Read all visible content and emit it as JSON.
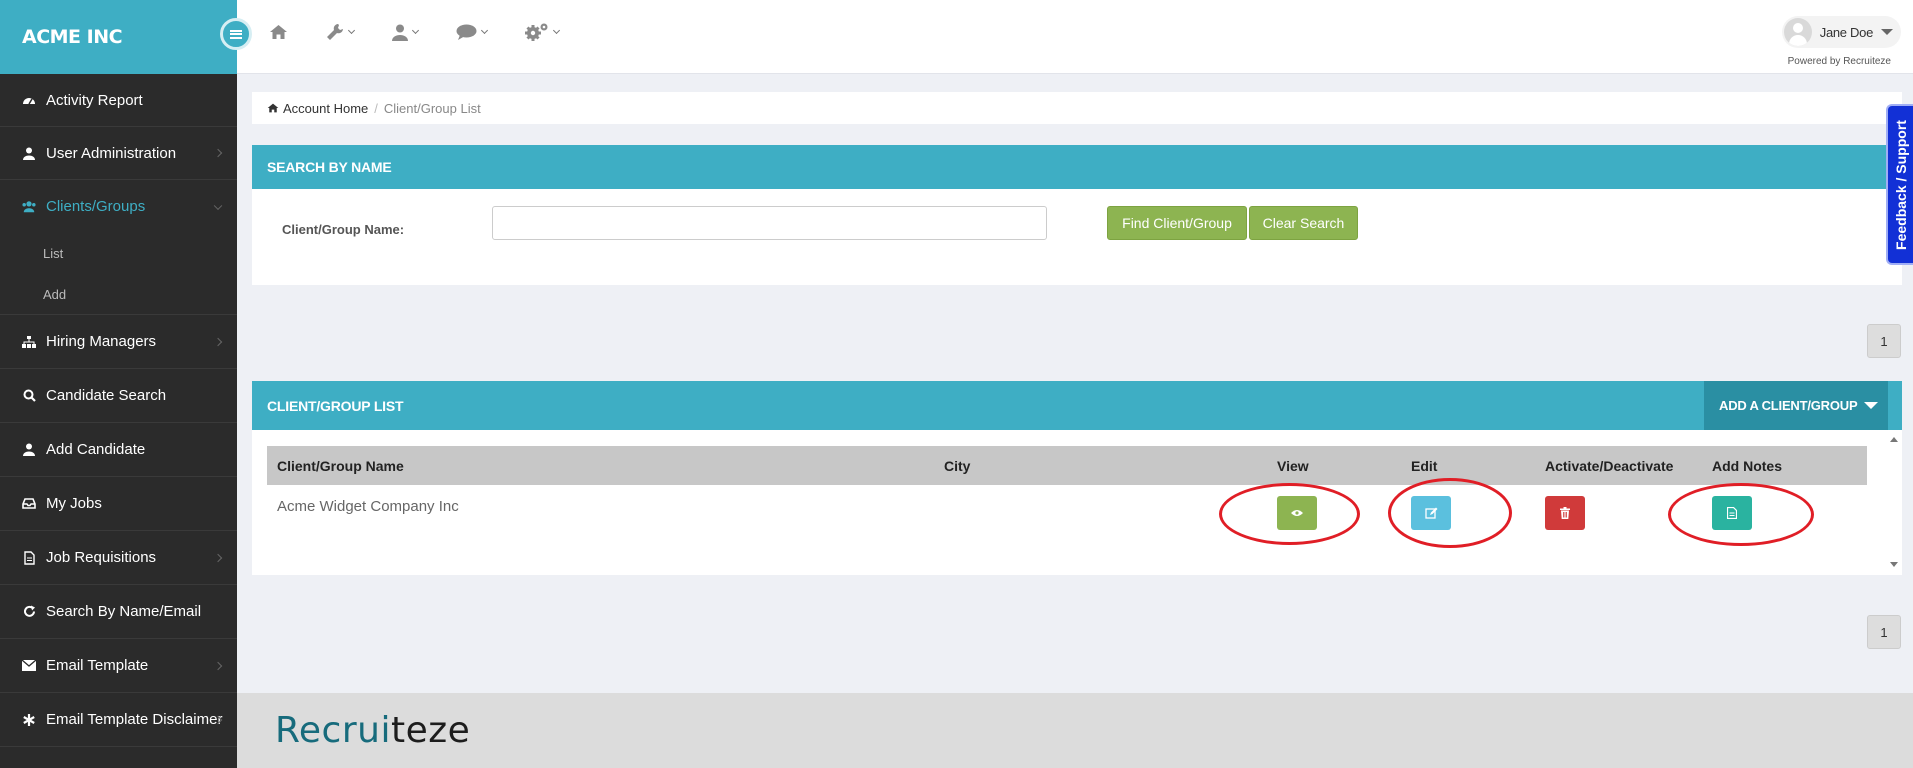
{
  "brand": {
    "name": "ACME INC"
  },
  "sidebar": {
    "items": [
      {
        "label": "Activity Report",
        "icon": "dashboard-icon"
      },
      {
        "label": "User Administration",
        "icon": "user-icon"
      },
      {
        "label": "Clients/Groups",
        "icon": "users-icon",
        "sub": [
          "List",
          "Add"
        ]
      },
      {
        "label": "Hiring Managers",
        "icon": "sitemap-icon"
      },
      {
        "label": "Candidate Search",
        "icon": "search-icon"
      },
      {
        "label": "Add Candidate",
        "icon": "user-icon"
      },
      {
        "label": "My Jobs",
        "icon": "inbox-icon"
      },
      {
        "label": "Job Requisitions",
        "icon": "document-icon"
      },
      {
        "label": "Search By Name/Email",
        "icon": "refresh-icon"
      },
      {
        "label": "Email Template",
        "icon": "envelope-icon"
      },
      {
        "label": "Email Template Disclaimer",
        "icon": "asterisk-icon"
      }
    ]
  },
  "header": {
    "user_name": "Jane Doe",
    "powered_by": "Powered by Recruiteze"
  },
  "breadcrumb": {
    "home": "Account Home",
    "separator": "/",
    "current": "Client/Group List"
  },
  "search": {
    "title": "SEARCH BY NAME",
    "label": "Client/Group Name:",
    "value": "",
    "find_label": "Find Client/Group",
    "clear_label": "Clear Search"
  },
  "pager": {
    "page": "1"
  },
  "list": {
    "title": "CLIENT/GROUP LIST",
    "add_label": "ADD A CLIENT/GROUP",
    "columns": [
      "Client/Group Name",
      "City",
      "View",
      "Edit",
      "Activate/Deactivate",
      "Add Notes"
    ],
    "rows": [
      {
        "name": "Acme Widget Company Inc",
        "city": ""
      }
    ]
  },
  "feedback": {
    "label": "Feedback / Support"
  },
  "footer": {
    "logo_part1": "Recrui",
    "logo_part2": "teze"
  },
  "colors": {
    "accent": "#3eaec4",
    "sidebar": "#2b2b2b",
    "green": "#8db451",
    "annotation": "#e01e26"
  }
}
